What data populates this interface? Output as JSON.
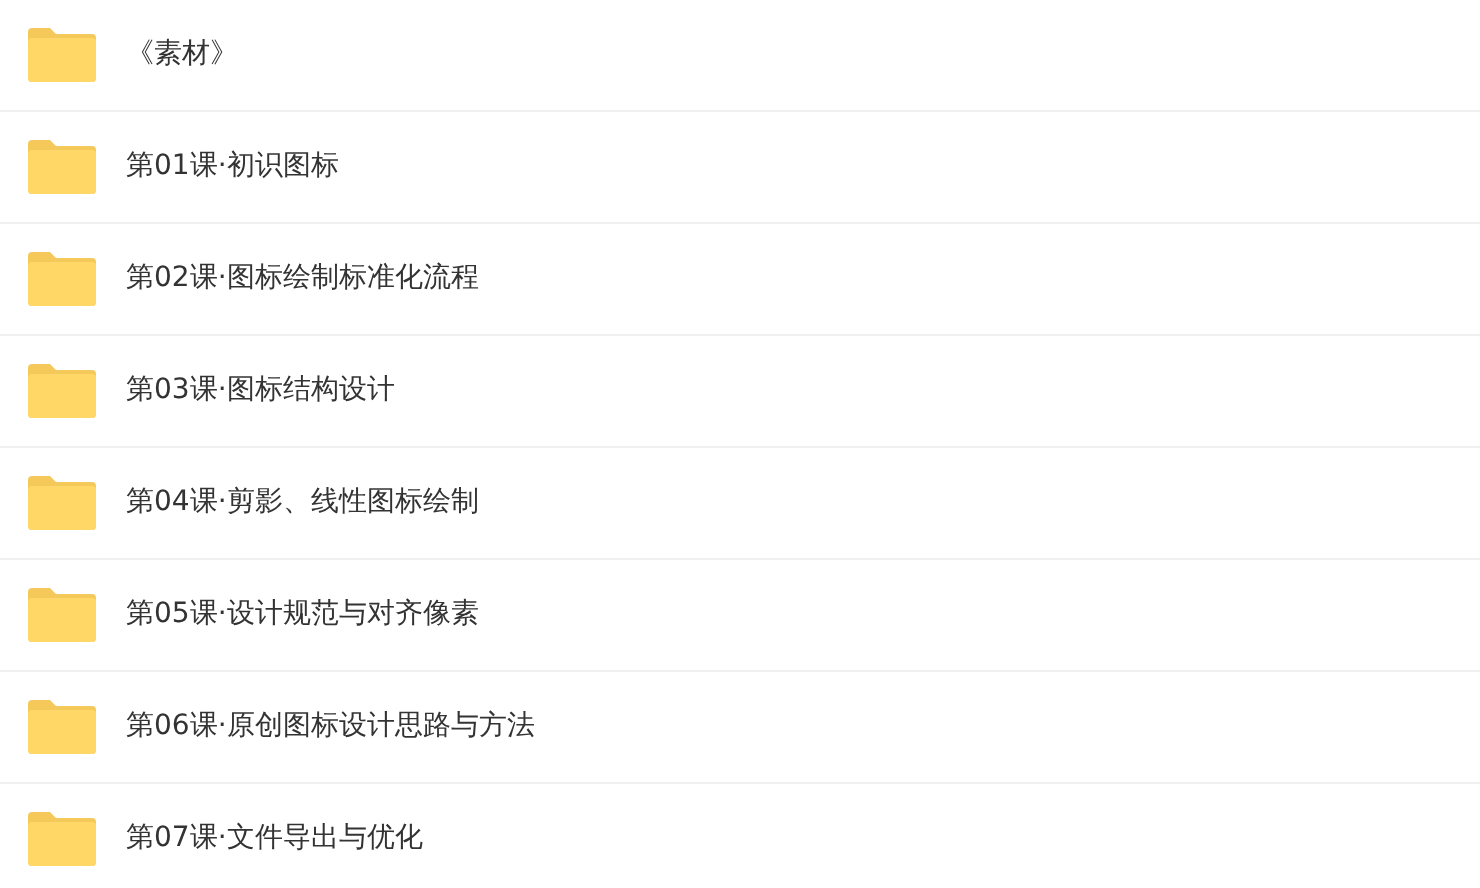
{
  "folders": [
    {
      "name": "《素材》"
    },
    {
      "name": "第01课·初识图标"
    },
    {
      "name": "第02课·图标绘制标准化流程"
    },
    {
      "name": "第03课·图标结构设计"
    },
    {
      "name": "第04课·剪影、线性图标绘制"
    },
    {
      "name": "第05课·设计规范与对齐像素"
    },
    {
      "name": "第06课·原创图标设计思路与方法"
    },
    {
      "name": "第07课·文件导出与优化"
    }
  ]
}
